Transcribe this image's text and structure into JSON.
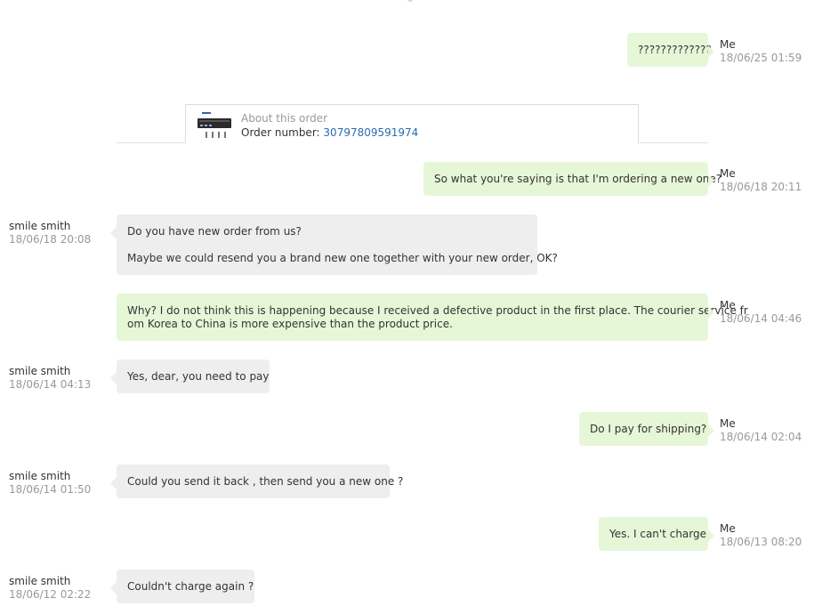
{
  "order": {
    "title": "About this order",
    "number_label": "Order number:",
    "number": "30797809591974"
  },
  "messages": [
    {
      "side": "me",
      "sender": "Me",
      "time": "18/06/25 01:59",
      "lines": [
        "?????????????"
      ]
    },
    {
      "side": "me",
      "sender": "Me",
      "time": "18/06/18 20:11",
      "lines": [
        "So what you're saying is that I'm ordering a new one?"
      ]
    },
    {
      "side": "them",
      "sender": "smile smith",
      "time": "18/06/18 20:08",
      "lines": [
        "Do you have new order from us?",
        "",
        "Maybe we could resend you a brand new one together with your new order, OK?"
      ]
    },
    {
      "side": "me",
      "sender": "Me",
      "time": "18/06/14 04:46",
      "lines": [
        "Why? I do not think this is happening because I received a defective product in the first place. The courier service fr",
        "om Korea to China is more expensive than the product price."
      ]
    },
    {
      "side": "them",
      "sender": "smile smith",
      "time": "18/06/14 04:13",
      "lines": [
        "Yes, dear, you need to pay"
      ]
    },
    {
      "side": "me",
      "sender": "Me",
      "time": "18/06/14 02:04",
      "lines": [
        "Do I pay for shipping?"
      ]
    },
    {
      "side": "them",
      "sender": "smile smith",
      "time": "18/06/14 01:50",
      "lines": [
        "Could you send it back , then send you a new one ?"
      ]
    },
    {
      "side": "me",
      "sender": "Me",
      "time": "18/06/13 08:20",
      "lines": [
        "Yes. I can't charge"
      ]
    },
    {
      "side": "them",
      "sender": "smile smith",
      "time": "18/06/12 02:22",
      "lines": [
        "Couldn't charge again ?"
      ]
    }
  ]
}
